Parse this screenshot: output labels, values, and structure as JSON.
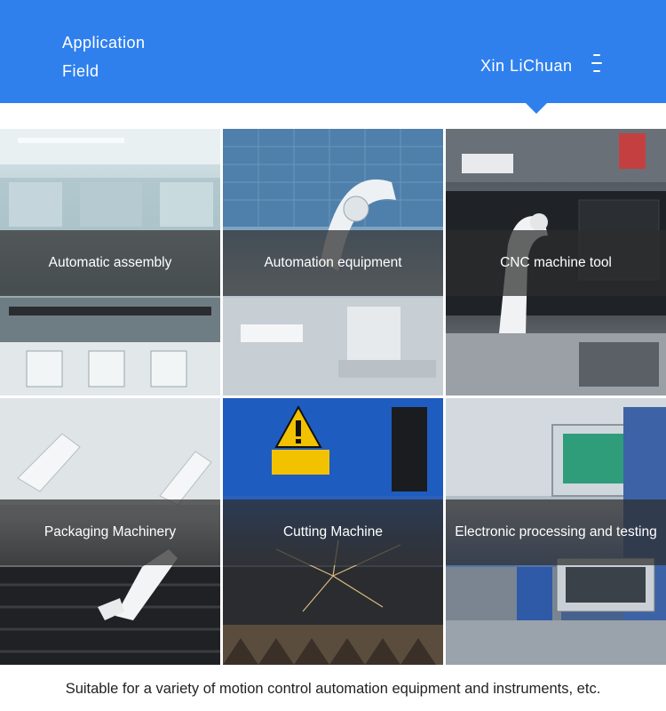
{
  "header": {
    "title_line1": "Application",
    "title_line2": "Field",
    "brand": "Xin LiChuan",
    "menu_icon": "hamburger-menu-icon",
    "color": "#2f80ed"
  },
  "fields": [
    {
      "label": "Automatic assembly"
    },
    {
      "label": "Automation equipment"
    },
    {
      "label": "CNC machine tool"
    },
    {
      "label": "Packaging Machinery"
    },
    {
      "label": "Cutting Machine"
    },
    {
      "label": "Electronic processing and testing"
    }
  ],
  "footer": {
    "text": "Suitable for a variety of motion control automation equipment and instruments, etc."
  }
}
